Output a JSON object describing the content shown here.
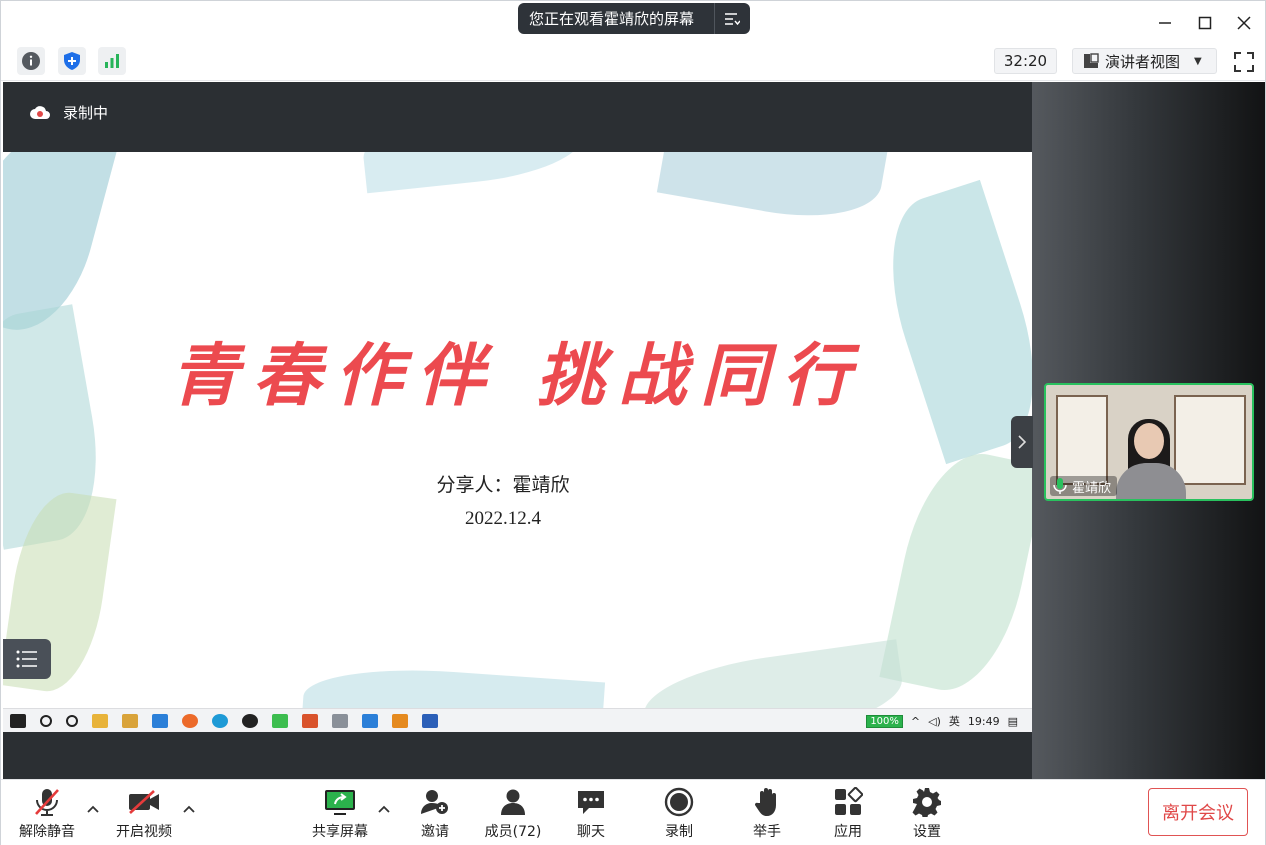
{
  "titlebar": {
    "watching_text": "您正在观看霍靖欣的屏幕"
  },
  "toolbar": {
    "timer": "32:20",
    "view_mode_label": "演讲者视图"
  },
  "stage": {
    "recording_label": "录制中",
    "slide": {
      "title": "青春作伴  挑战同行",
      "presenter": "分享人：霍靖欣",
      "date": "2022.12.4"
    },
    "taskbar": {
      "battery": "100%",
      "ime": "英",
      "clock": "19:49"
    }
  },
  "participant": {
    "name": "霍靖欣"
  },
  "bottombar": {
    "unmute_label": "解除静音",
    "video_label": "开启视频",
    "share_label": "共享屏幕",
    "invite_label": "邀请",
    "members_label": "成员(72)",
    "chat_label": "聊天",
    "record_label": "录制",
    "raise_hand_label": "举手",
    "apps_label": "应用",
    "settings_label": "设置",
    "leave_label": "离开会议"
  },
  "colors": {
    "accent_green": "#29c15e",
    "leave_red": "#e04848",
    "slide_title_red": "#ec4a4f",
    "toolbar_blue": "#1e6fe8"
  },
  "icons": [
    "info-icon",
    "shield-icon",
    "signal-icon",
    "layout-icon",
    "fullscreen-icon",
    "cloud-record-icon",
    "list-icon",
    "mic-muted-icon",
    "camera-off-icon",
    "share-screen-icon",
    "invite-icon",
    "members-icon",
    "chat-icon",
    "record-icon",
    "hand-icon",
    "apps-icon",
    "gear-icon"
  ]
}
